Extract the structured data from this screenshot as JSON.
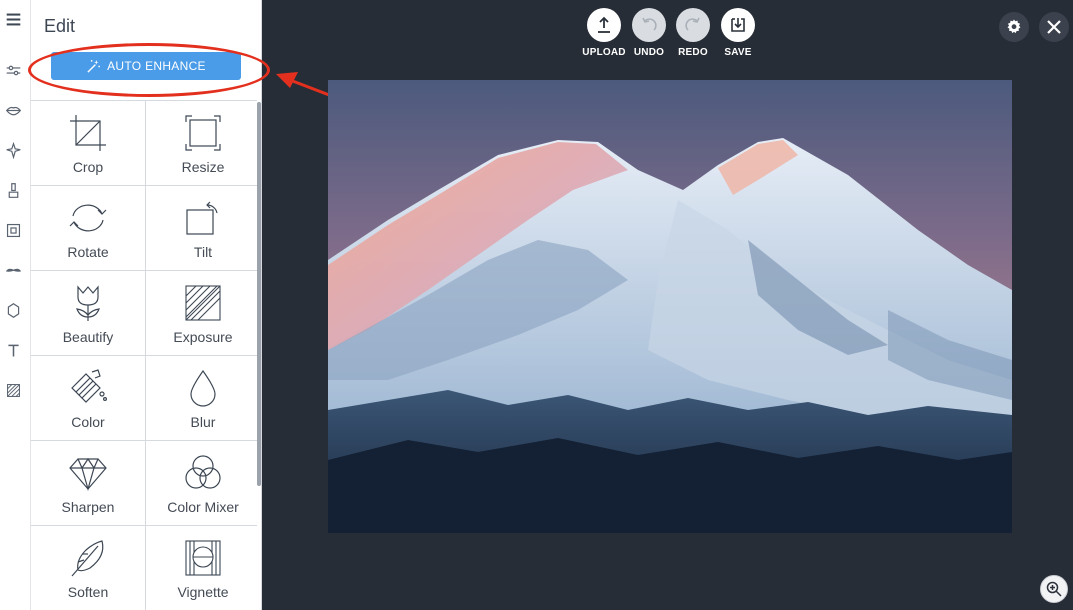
{
  "panel": {
    "title": "Edit",
    "auto_enhance_label": "AUTO ENHANCE"
  },
  "tools": [
    {
      "label": "Crop",
      "icon": "crop-icon"
    },
    {
      "label": "Resize",
      "icon": "resize-icon"
    },
    {
      "label": "Rotate",
      "icon": "rotate-icon"
    },
    {
      "label": "Tilt",
      "icon": "tilt-icon"
    },
    {
      "label": "Beautify",
      "icon": "tulip-icon"
    },
    {
      "label": "Exposure",
      "icon": "exposure-icon"
    },
    {
      "label": "Color",
      "icon": "paint-bucket-icon"
    },
    {
      "label": "Blur",
      "icon": "droplet-icon"
    },
    {
      "label": "Sharpen",
      "icon": "diamond-icon"
    },
    {
      "label": "Color Mixer",
      "icon": "color-mixer-icon"
    },
    {
      "label": "Soften",
      "icon": "feather-icon"
    },
    {
      "label": "Vignette",
      "icon": "vignette-icon"
    }
  ],
  "rail": [
    "menu-icon",
    "sliders-icon",
    "lips-icon",
    "sparkle-icon",
    "brush-icon",
    "frame-icon",
    "mustache-icon",
    "sticker-icon",
    "text-icon",
    "texture-icon"
  ],
  "toolbar": {
    "upload": "UPLOAD",
    "undo": "UNDO",
    "redo": "REDO",
    "save": "SAVE"
  },
  "colors": {
    "canvas_bg": "#272d36",
    "accent": "#4a9be8",
    "highlight": "#e3301e"
  }
}
